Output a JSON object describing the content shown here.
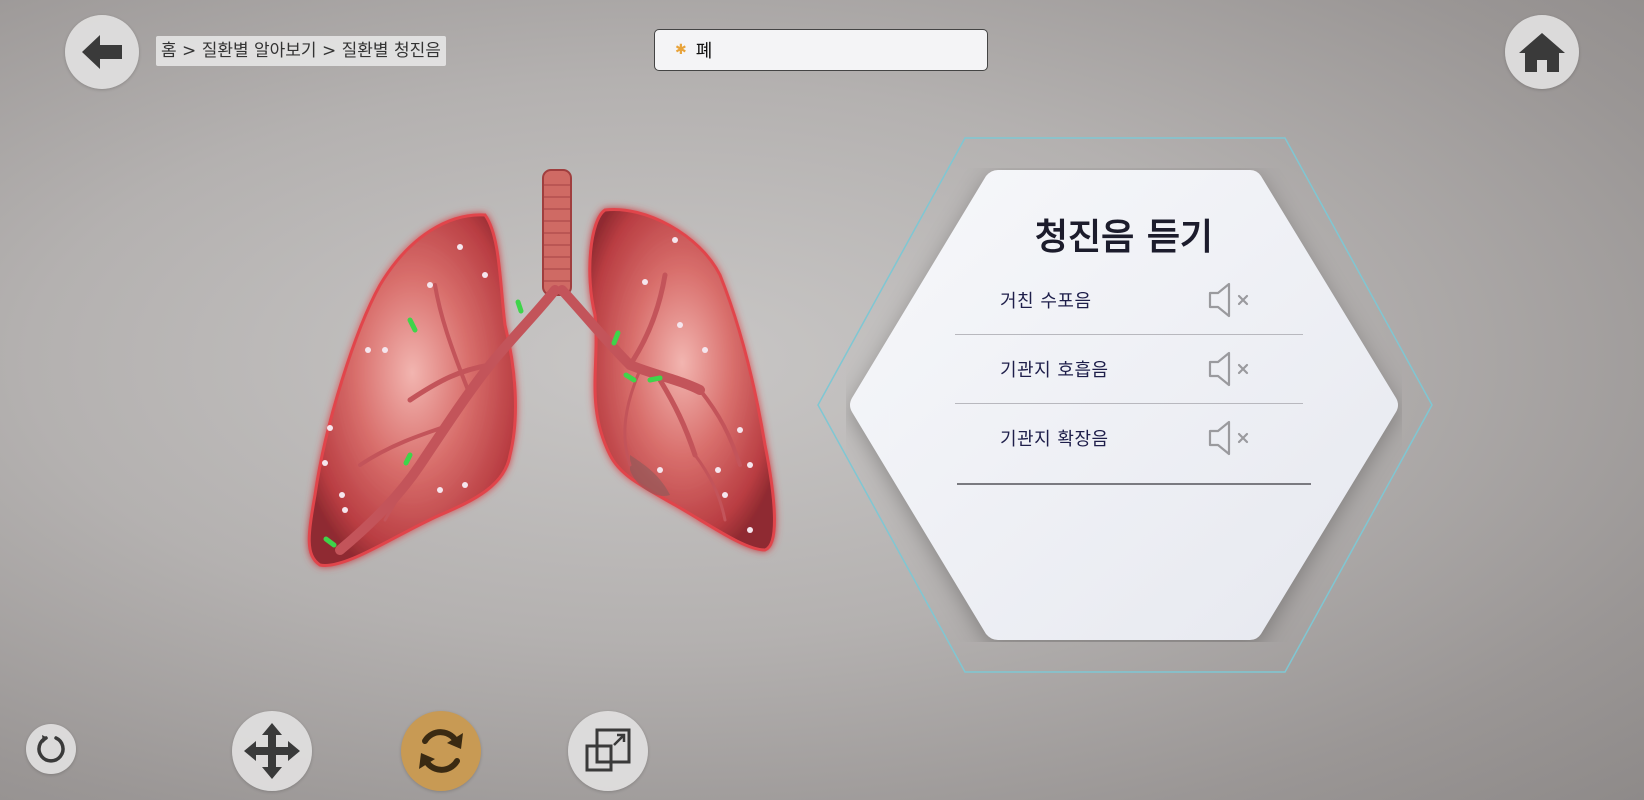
{
  "header": {
    "breadcrumb": "홈 > 질환별 알아보기 > 질환별 청진음",
    "search": {
      "value": "폐"
    }
  },
  "panel": {
    "title": "청진음 듣기",
    "sounds": [
      {
        "label": "거친 수포음",
        "state": "muted"
      },
      {
        "label": "기관지 호흡음",
        "state": "muted"
      },
      {
        "label": "기관지 확장음",
        "state": "muted"
      }
    ]
  },
  "toolbar": {
    "active_tool": "rotate"
  },
  "colors": {
    "accent_rotate": "#c89a54",
    "search_star": "#e8a33a",
    "hex_outline": "#7fc7d3",
    "lung_red": "#c8484c"
  },
  "icons": {
    "back": "arrow-left-icon",
    "home": "home-icon",
    "sound": "speaker-muted-icon",
    "reset": "reset-icon",
    "move": "move-arrows-icon",
    "rotate": "rotate-icon",
    "scale": "scale-icon"
  }
}
